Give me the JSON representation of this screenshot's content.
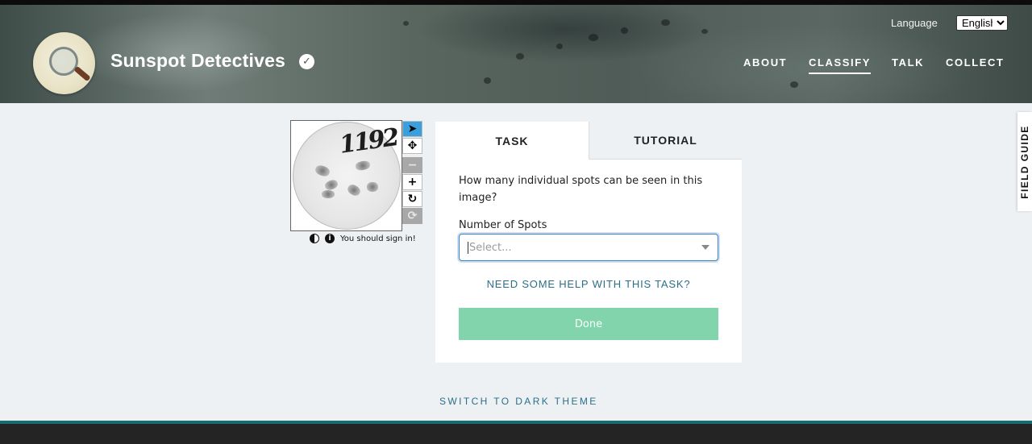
{
  "header": {
    "project_title": "Sunspot Detectives",
    "verified_icon": "check-circle-icon",
    "language_label": "Language",
    "language_selected": "English",
    "nav": [
      {
        "label": "ABOUT",
        "active": false
      },
      {
        "label": "CLASSIFY",
        "active": true
      },
      {
        "label": "TALK",
        "active": false
      },
      {
        "label": "COLLECT",
        "active": false
      }
    ]
  },
  "subject": {
    "handwritten_number": "1192",
    "tools": [
      {
        "name": "annotate-pointer-icon",
        "glyph": "➤",
        "state": "selected"
      },
      {
        "name": "move-icon",
        "glyph": "✥",
        "state": "normal"
      },
      {
        "name": "zoom-out-icon",
        "glyph": "−",
        "state": "disabled"
      },
      {
        "name": "zoom-in-icon",
        "glyph": "+",
        "state": "normal"
      },
      {
        "name": "rotate-icon",
        "glyph": "↻",
        "state": "normal"
      },
      {
        "name": "reset-icon",
        "glyph": "⟳",
        "state": "disabled"
      }
    ],
    "invert_icon": "contrast-icon",
    "info_icon": "info-icon",
    "info_glyph": "i",
    "sign_in_message": "You should sign in!"
  },
  "task_panel": {
    "tabs": [
      "TASK",
      "TUTORIAL"
    ],
    "question": "How many individual spots can be seen in this image?",
    "field_label": "Number of Spots",
    "select_placeholder": "Select...",
    "help_link": "NEED SOME HELP WITH THIS TASK?",
    "done_label": "Done"
  },
  "field_guide_label": "FIELD GUIDE",
  "theme_toggle_label": "SWITCH TO DARK THEME",
  "colors": {
    "accent": "#2b6f87",
    "done_button": "#82d4ad",
    "selected_tool": "#3aa0dd",
    "footer": "#242424"
  }
}
